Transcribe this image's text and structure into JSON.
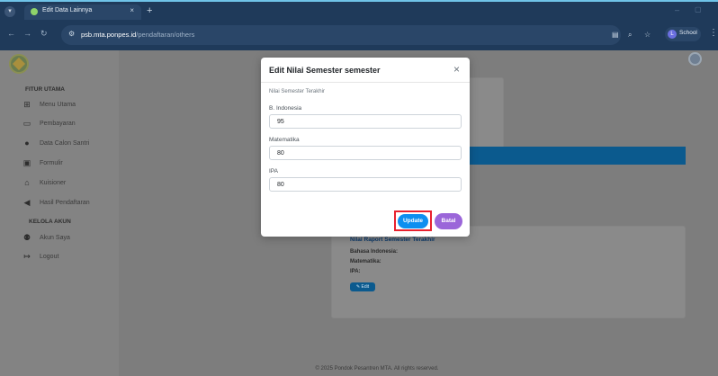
{
  "browser": {
    "tab_title": "Edit Data Lainnya",
    "tab_close": "×",
    "new_tab": "+",
    "url_host": "psb.mta.ponpes.id",
    "url_path": "/pendaftaran/others",
    "profile_label": "School",
    "profile_initial": "L"
  },
  "sidebar": {
    "section_main": "FITUR UTAMA",
    "items": [
      {
        "label": "Menu Utama",
        "icon": "grid-icon"
      },
      {
        "label": "Pembayaran",
        "icon": "card-icon"
      },
      {
        "label": "Data Calon Santri",
        "icon": "user-icon"
      },
      {
        "label": "Formulir",
        "icon": "form-icon"
      },
      {
        "label": "Kuisioner",
        "icon": "questionnaire-icon"
      },
      {
        "label": "Hasil Pendaftaran",
        "icon": "megaphone-icon"
      }
    ],
    "section_account": "KELOLA AKUN",
    "account_items": [
      {
        "label": "Akun Saya",
        "icon": "users-icon"
      },
      {
        "label": "Logout",
        "icon": "logout-icon"
      }
    ]
  },
  "background": {
    "info_title": "Nilai Raport Semester Terakhir",
    "info_lines": [
      "Bahasa Indonesia:",
      "Matematika:",
      "IPA:"
    ],
    "edit_label": "Edit",
    "footer": "© 2025 Pondok Pesantren MTA. All rights reserved."
  },
  "modal": {
    "title": "Edit Nilai Semester semester",
    "close": "×",
    "group_label": "Nilai Semester Terakhir",
    "fields": [
      {
        "label": "B. Indonesia",
        "value": "95"
      },
      {
        "label": "Matematika",
        "value": "80"
      },
      {
        "label": "IPA",
        "value": "80"
      }
    ],
    "update_label": "Update",
    "cancel_label": "Batal"
  },
  "colors": {
    "primary": "#0d8ff0",
    "cancel": "#9b66d9",
    "highlight": "#e8222f",
    "band": "#0b5a8e"
  }
}
